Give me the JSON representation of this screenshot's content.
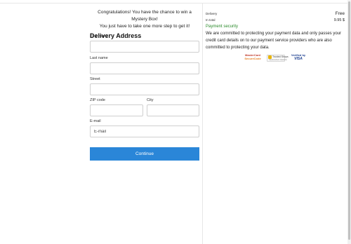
{
  "promo": {
    "line1": "Congratulations! You have the chance to win a Mystery Box!",
    "line2": "You just have to take one more step to get it!"
  },
  "form": {
    "heading": "Delivery Address",
    "first_name_label": "First name",
    "first_name_value": "",
    "last_name_label": "Last name",
    "last_name_value": "",
    "street_label": "Street",
    "street_value": "",
    "zip_label": "ZIP code",
    "zip_value": "",
    "city_label": "City",
    "city_value": "",
    "email_label": "E-mail",
    "email_placeholder": "E-mail",
    "email_value": "",
    "continue_label": "Continue"
  },
  "summary": {
    "delivery_label": "Delivery",
    "delivery_value": "Free",
    "total_label": "In total",
    "total_value": "9.95 $",
    "security_title": "Payment security",
    "security_text": "We are committed to protecting your payment data and only passes your credit card details on to our payment service providers who are also committed to protecting your data.",
    "badges": {
      "mastercard_line1": "MasterCard",
      "mastercard_line2": "SecureCode",
      "trusted_line1": "Trusted Shops",
      "trusted_line2": "Käuferschutz Garantie",
      "visa_line1": "Verified by",
      "visa_line2": "VISA"
    }
  },
  "colors": {
    "accent": "#2a86d8",
    "security_green": "#2a8a2a",
    "border": "#cfcfcf"
  }
}
